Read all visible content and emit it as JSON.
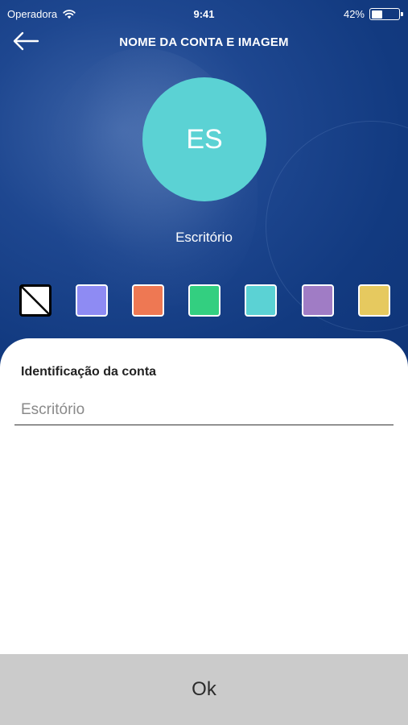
{
  "status_bar": {
    "carrier": "Operadora",
    "time": "9:41",
    "battery_percent": "42%",
    "battery_level": 0.42
  },
  "header": {
    "title": "NOME DA CONTA E IMAGEM",
    "back_icon": "arrow-left-icon"
  },
  "avatar": {
    "initials": "ES",
    "color": "#5bd2d4"
  },
  "account_name": "Escritório",
  "colors": {
    "header_bg": "#123a80",
    "swatches": [
      "none",
      "#8e8bf3",
      "#ee7853",
      "#33cf80",
      "#5bd2d4",
      "#a07cc5",
      "#e6c95f"
    ]
  },
  "form": {
    "label": "Identificação da conta",
    "placeholder": "Escritório",
    "value": ""
  },
  "footer": {
    "ok_label": "Ok"
  }
}
